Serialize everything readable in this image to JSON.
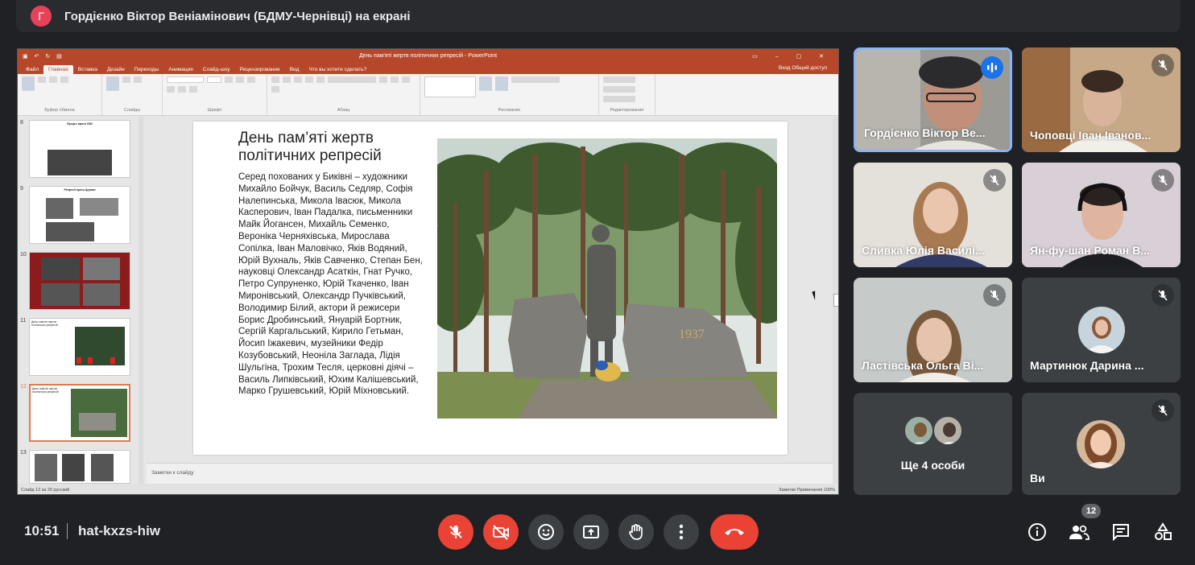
{
  "header": {
    "avatar_letter": "Г",
    "presenter_text": "Гордієнко Віктор Веніамінович (БДМУ-Чернівці) на екрані"
  },
  "powerpoint": {
    "doc_title": "День пам'яті жертв політичних репресій - PowerPoint",
    "tabs": [
      "Файл",
      "Главная",
      "Вставка",
      "Дизайн",
      "Переходы",
      "Анимация",
      "Слайд-шоу",
      "Рецензирование",
      "Вид",
      "Что вы хотите сделать?"
    ],
    "active_tab": "Главная",
    "share": "Вход   Общий доступ",
    "ribbon_groups": [
      "Буфер обмена",
      "Слайды",
      "Шрифт",
      "Абзац",
      "Рисование",
      "Редактирование"
    ],
    "thumbnails": [
      {
        "num": "8",
        "title": "Процес проти СВУ"
      },
      {
        "num": "9",
        "title": "Репресії проти Церкви"
      },
      {
        "num": "10",
        "title": ""
      },
      {
        "num": "11",
        "title": "День пам'яті жертв політичних репресій"
      },
      {
        "num": "12",
        "title": "День пам'яті жертв політичних репресій"
      },
      {
        "num": "13",
        "title": ""
      }
    ],
    "slide": {
      "title": "День пам’яті жертв політичних репресій",
      "body": "Серед похованих у Биківні – художники Михайло Бойчук, Василь Седляр, Софія Налепинська, Микола Івасюк, Микола Касперович, Іван Падалка, письменники Майк Йогансен, Михайль Семенко, Вероніка Черняхівська, Мирослава Сопілка, Іван Маловічко, Яків Водяний, Юрій Вухналь, Яків Савченко, Степан Бен, науковці Олександр Асаткін, Гнат Ручко, Петро Супруненко, Юрій Ткаченко, Іван Миронівський, Олександр Пучківський, Володимир Білий, актори й режисери Борис Дробинський, Януарій Бортник, Сергій Каргальський, Кирило Гетьман, Йосип Іжакевич, музейники Федір Козубовський, Неоніла Заглада, Лідія Шульгіна, Трохим Тесля, церковні діячі – Василь Липківський, Юхим Калішевський, Марко Грушевський, Юрій Міхновський.",
      "photo_year": "1937"
    },
    "notes_placeholder": "Заметки к слайду",
    "status_left": "Слайд 12 из 20   русский",
    "status_right": "Заметки   Примечания      100%"
  },
  "participants": [
    {
      "name": "Гордієнко Віктор Ве...",
      "muted": false,
      "speaking": true
    },
    {
      "name": "Чоповці Іван Іванов...",
      "muted": true
    },
    {
      "name": "Сливка Юлія Василі...",
      "muted": true
    },
    {
      "name": "Ян-фу-шан Роман В...",
      "muted": true
    },
    {
      "name": "Ластівська Ольга Ві...",
      "muted": true
    },
    {
      "name": "Мартинюк Дарина ...",
      "muted": true
    },
    {
      "name": "Ще 4 особи"
    },
    {
      "name": "Ви",
      "muted": true
    }
  ],
  "bottom": {
    "time": "10:51",
    "meeting_code": "hat-kxzs-hiw",
    "participant_count": "12"
  },
  "colors": {
    "meet_bg": "#202124",
    "red": "#ea4335",
    "ppt_accent": "#b7472a",
    "active_speaker": "#8ab4f8"
  }
}
